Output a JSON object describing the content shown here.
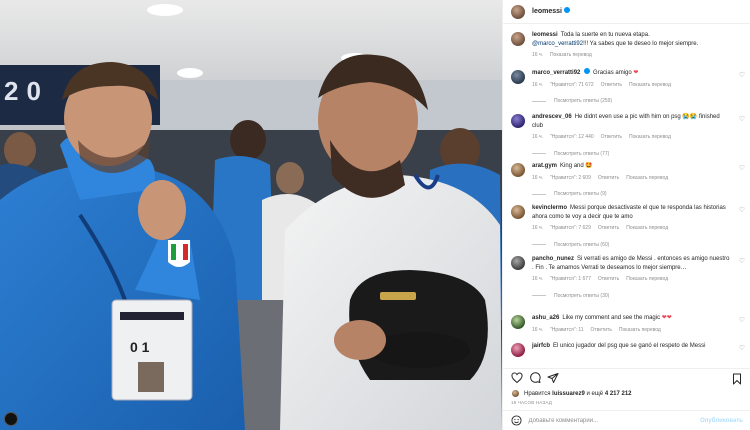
{
  "post": {
    "username": "leomessi",
    "caption_text": "Toda la suerte en tu nueva etapa.",
    "caption_mention": "@marco_verratti92",
    "caption_text_2": "!!! Ya sabes que te deseo lo mejor siempre.",
    "caption_time": "16 ч.",
    "caption_translate": "Показать перевод"
  },
  "comments": [
    {
      "user": "marco_verratti92",
      "text": "Gracias amigo ",
      "emoji": "❤",
      "time": "16 ч.",
      "likes": "\"Нравится\": 71 672",
      "reply": "Ответить",
      "translate": "Показать перевод",
      "replies": "Посмотреть ответы (259)"
    },
    {
      "user": "andrescev_06",
      "text": "He didnt even use a pic with him on psg 😭😭 finished club",
      "time": "16 ч.",
      "likes": "\"Нравится\": 12 440",
      "reply": "Ответить",
      "translate": "Показать перевод",
      "replies": "Посмотреть ответы (77)"
    },
    {
      "user": "arat.gym",
      "text": "King and 🤩",
      "time": "16 ч.",
      "likes": "\"Нравится\": 2 609",
      "reply": "Ответить",
      "translate": "Показать перевод",
      "replies": "Посмотреть ответы (9)"
    },
    {
      "user": "kevinclermo",
      "text": "Messi porque desactivaste el que te responda las historias ahora como te voy a decir que te amo",
      "time": "16 ч.",
      "likes": "\"Нравится\": 7 629",
      "reply": "Ответить",
      "translate": "Показать перевод",
      "replies": "Посмотреть ответы (60)"
    },
    {
      "user": "pancho_nunez",
      "text": "Si verrati es amigo de Messi . entonces es amigo nuestro . Fin . Te amamos Verrati te deseamos lo mejor siempre…",
      "time": "16 ч.",
      "likes": "\"Нравится\": 1 677",
      "reply": "Ответить",
      "translate": "Показать перевод",
      "replies": "Посмотреть ответы (30)"
    },
    {
      "user": "ashu_a26",
      "text": "Like my comment and see the magic ",
      "emoji": "❤❤",
      "time": "16 ч.",
      "likes": "\"Нравится\": 11",
      "reply": "Ответить",
      "translate": "Показать перевод",
      "replies": ""
    },
    {
      "user": "jairfcb",
      "text": "El unico jugador del psg que se ganó el respeto de Messi",
      "time": "",
      "likes": "",
      "reply": "",
      "translate": "",
      "replies": ""
    }
  ],
  "likes": {
    "prefix": "Нравится",
    "user": "luissuarez9",
    "middle": "и ещё",
    "count": "4 217 212"
  },
  "time_ago": "16 ЧАСОВ НАЗАД",
  "add_comment": {
    "placeholder": "Добавьте комментарий...",
    "publish": "Опубликовать"
  },
  "photo_text": {
    "scoreboard": "20",
    "credential_number": "0 1"
  },
  "icons": {
    "heart": "heart-icon",
    "comment": "comment-icon",
    "share": "share-icon",
    "bookmark": "bookmark-icon",
    "emoji": "emoji-icon"
  },
  "colors": {
    "verified": "#0095f6",
    "mention": "#00376b",
    "heart": "#ed4956"
  }
}
